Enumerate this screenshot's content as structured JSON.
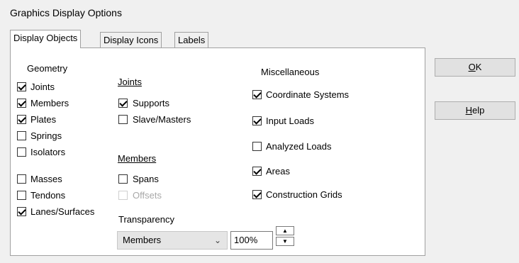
{
  "window": {
    "title": "Graphics Display Options"
  },
  "tabs": [
    {
      "label": "Display Objects",
      "active": true
    },
    {
      "label": "Display Icons",
      "active": false
    },
    {
      "label": "Labels",
      "active": false
    }
  ],
  "geometry": {
    "heading": "Geometry",
    "items": [
      {
        "label": "Joints",
        "checked": true
      },
      {
        "label": "Members",
        "checked": true
      },
      {
        "label": "Plates",
        "checked": true
      },
      {
        "label": "Springs",
        "checked": false
      },
      {
        "label": "Isolators",
        "checked": false
      },
      {
        "label": "Masses",
        "checked": false
      },
      {
        "label": "Tendons",
        "checked": false
      },
      {
        "label": "Lanes/Surfaces",
        "checked": true
      }
    ]
  },
  "joints": {
    "heading": "Joints",
    "items": [
      {
        "label": "Supports",
        "checked": true
      },
      {
        "label": "Slave/Masters",
        "checked": false
      }
    ]
  },
  "members": {
    "heading": "Members",
    "items": [
      {
        "label": "Spans",
        "checked": false
      },
      {
        "label": "Offsets",
        "checked": false,
        "disabled": true
      }
    ]
  },
  "transparency": {
    "heading": "Transparency",
    "selected": "Members",
    "percent": "100%"
  },
  "misc": {
    "heading": "Miscellaneous",
    "items": [
      {
        "label": "Coordinate Systems",
        "checked": true
      },
      {
        "label": "Input Loads",
        "checked": true
      },
      {
        "label": "Analyzed Loads",
        "checked": false
      },
      {
        "label": "Areas",
        "checked": true
      },
      {
        "label": "Construction Grids",
        "checked": true
      }
    ]
  },
  "buttons": {
    "ok_mnemonic": "O",
    "ok_rest": "K",
    "help_mnemonic": "H",
    "help_rest": "elp"
  }
}
